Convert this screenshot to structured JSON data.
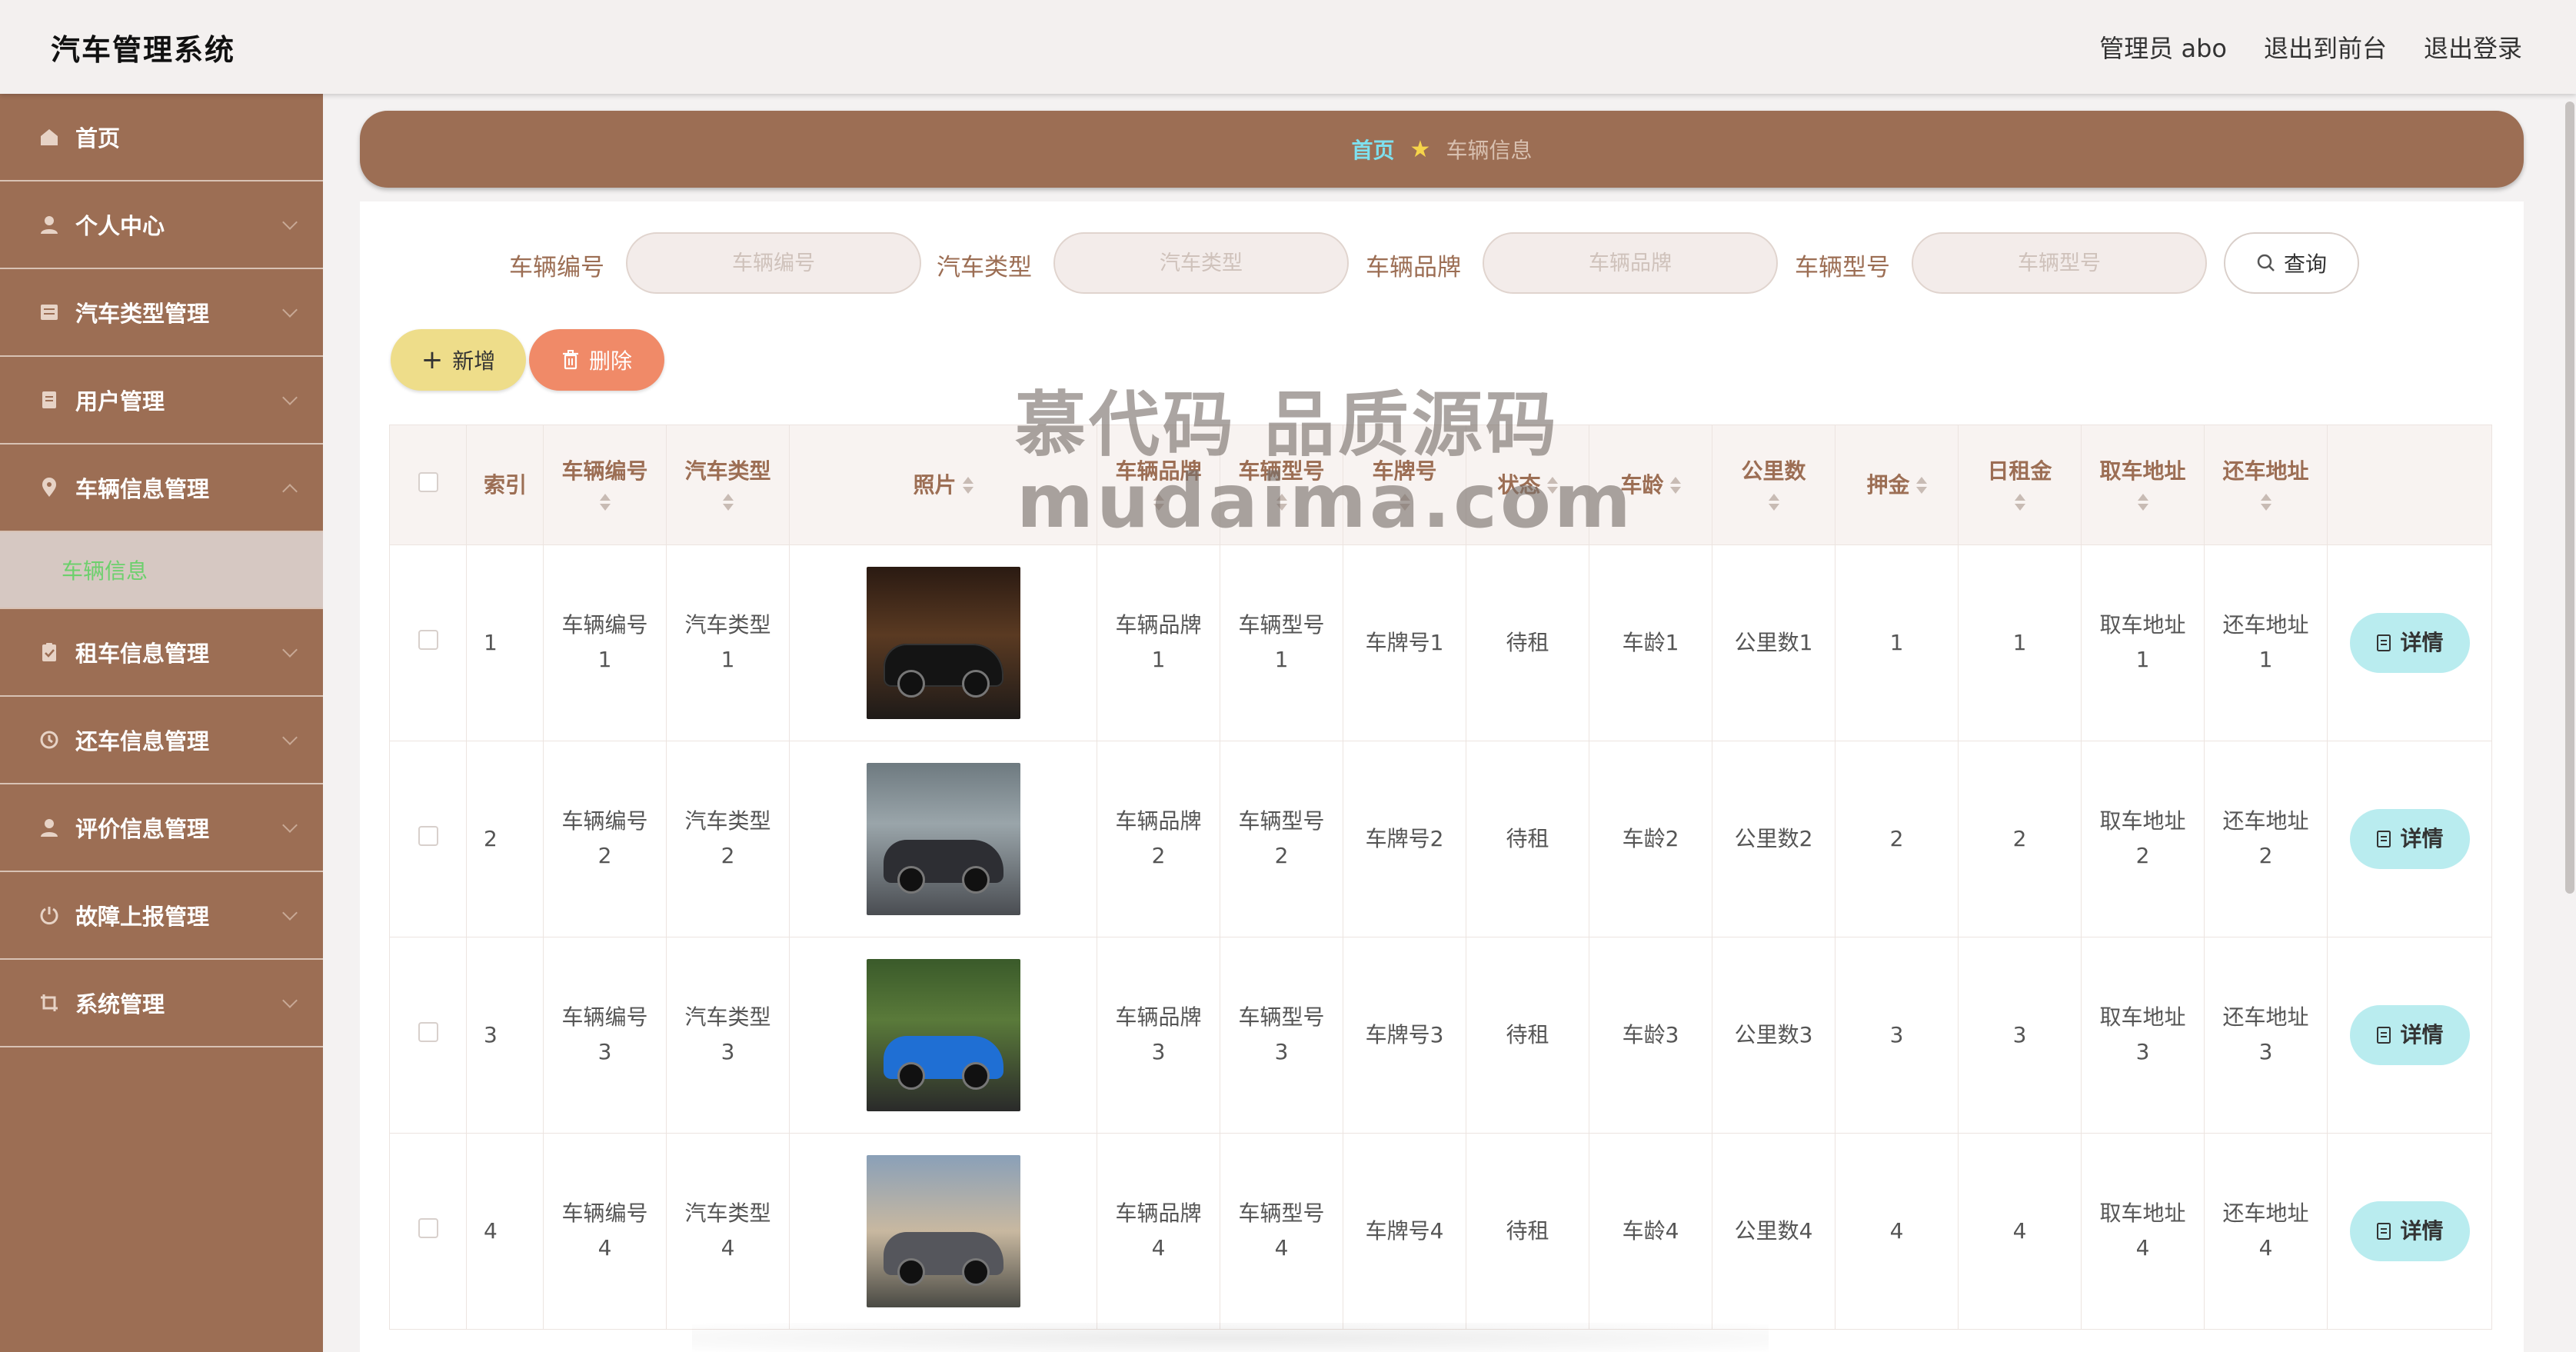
{
  "header": {
    "title": "汽车管理系统",
    "user": "管理员 abo",
    "front_link": "退出到前台",
    "logout": "退出登录"
  },
  "sidebar": {
    "items": [
      {
        "label": "首页",
        "icon": "home-icon"
      },
      {
        "label": "个人中心",
        "icon": "user-icon"
      },
      {
        "label": "汽车类型管理",
        "icon": "list-icon"
      },
      {
        "label": "用户管理",
        "icon": "file-icon"
      },
      {
        "label": "车辆信息管理",
        "icon": "location-icon"
      },
      {
        "label": "租车信息管理",
        "icon": "clipboard-icon"
      },
      {
        "label": "还车信息管理",
        "icon": "return-icon"
      },
      {
        "label": "评价信息管理",
        "icon": "user-icon"
      },
      {
        "label": "故障上报管理",
        "icon": "power-icon"
      },
      {
        "label": "系统管理",
        "icon": "crop-icon"
      }
    ],
    "active_sub": "车辆信息"
  },
  "breadcrumb": {
    "home": "首页",
    "current": "车辆信息"
  },
  "search": {
    "fields": [
      {
        "label": "车辆编号",
        "placeholder": "车辆编号"
      },
      {
        "label": "汽车类型",
        "placeholder": "汽车类型"
      },
      {
        "label": "车辆品牌",
        "placeholder": "车辆品牌"
      },
      {
        "label": "车辆型号",
        "placeholder": "车辆型号"
      }
    ],
    "query_label": "查询"
  },
  "toolbar": {
    "add_label": "新增",
    "delete_label": "删除"
  },
  "table": {
    "headers": {
      "index": "索引",
      "code": "车辆编号",
      "type": "汽车类型",
      "photo": "照片",
      "brand": "车辆品牌",
      "model": "车辆型号",
      "plate": "车牌号",
      "status": "状态",
      "age": "车龄",
      "mileage": "公里数",
      "deposit": "押金",
      "rent": "日租金",
      "pickup": "取车地址",
      "return": "还车地址"
    },
    "detail_label": "详情",
    "rows": [
      {
        "index": "1",
        "code": "车辆编号\n1",
        "type": "汽车类型\n1",
        "brand": "车辆品牌\n1",
        "model": "车辆型号\n1",
        "plate": "车牌号1",
        "status": "待租",
        "age": "车龄1",
        "mileage": "公里数1",
        "deposit": "1",
        "rent": "1",
        "pickup": "取车地址\n1",
        "return": "还车地址\n1"
      },
      {
        "index": "2",
        "code": "车辆编号\n2",
        "type": "汽车类型\n2",
        "brand": "车辆品牌\n2",
        "model": "车辆型号\n2",
        "plate": "车牌号2",
        "status": "待租",
        "age": "车龄2",
        "mileage": "公里数2",
        "deposit": "2",
        "rent": "2",
        "pickup": "取车地址\n2",
        "return": "还车地址\n2"
      },
      {
        "index": "3",
        "code": "车辆编号\n3",
        "type": "汽车类型\n3",
        "brand": "车辆品牌\n3",
        "model": "车辆型号\n3",
        "plate": "车牌号3",
        "status": "待租",
        "age": "车龄3",
        "mileage": "公里数3",
        "deposit": "3",
        "rent": "3",
        "pickup": "取车地址\n3",
        "return": "还车地址\n3"
      },
      {
        "index": "4",
        "code": "车辆编号\n4",
        "type": "汽车类型\n4",
        "brand": "车辆品牌\n4",
        "model": "车辆型号\n4",
        "plate": "车牌号4",
        "status": "待租",
        "age": "车龄4",
        "mileage": "公里数4",
        "deposit": "4",
        "rent": "4",
        "pickup": "取车地址\n4",
        "return": "还车地址\n4"
      }
    ]
  },
  "watermark": {
    "line1": "慕代码 品质源码",
    "line2": "mudaima.com"
  },
  "colors": {
    "sidebar": "#9c6e54",
    "accent_cyan": "#7ee0ee",
    "add_button": "#eedd8a",
    "delete_button": "#f08a68",
    "detail_button": "#b9ecef",
    "active_sub_text": "#6cd06c"
  }
}
